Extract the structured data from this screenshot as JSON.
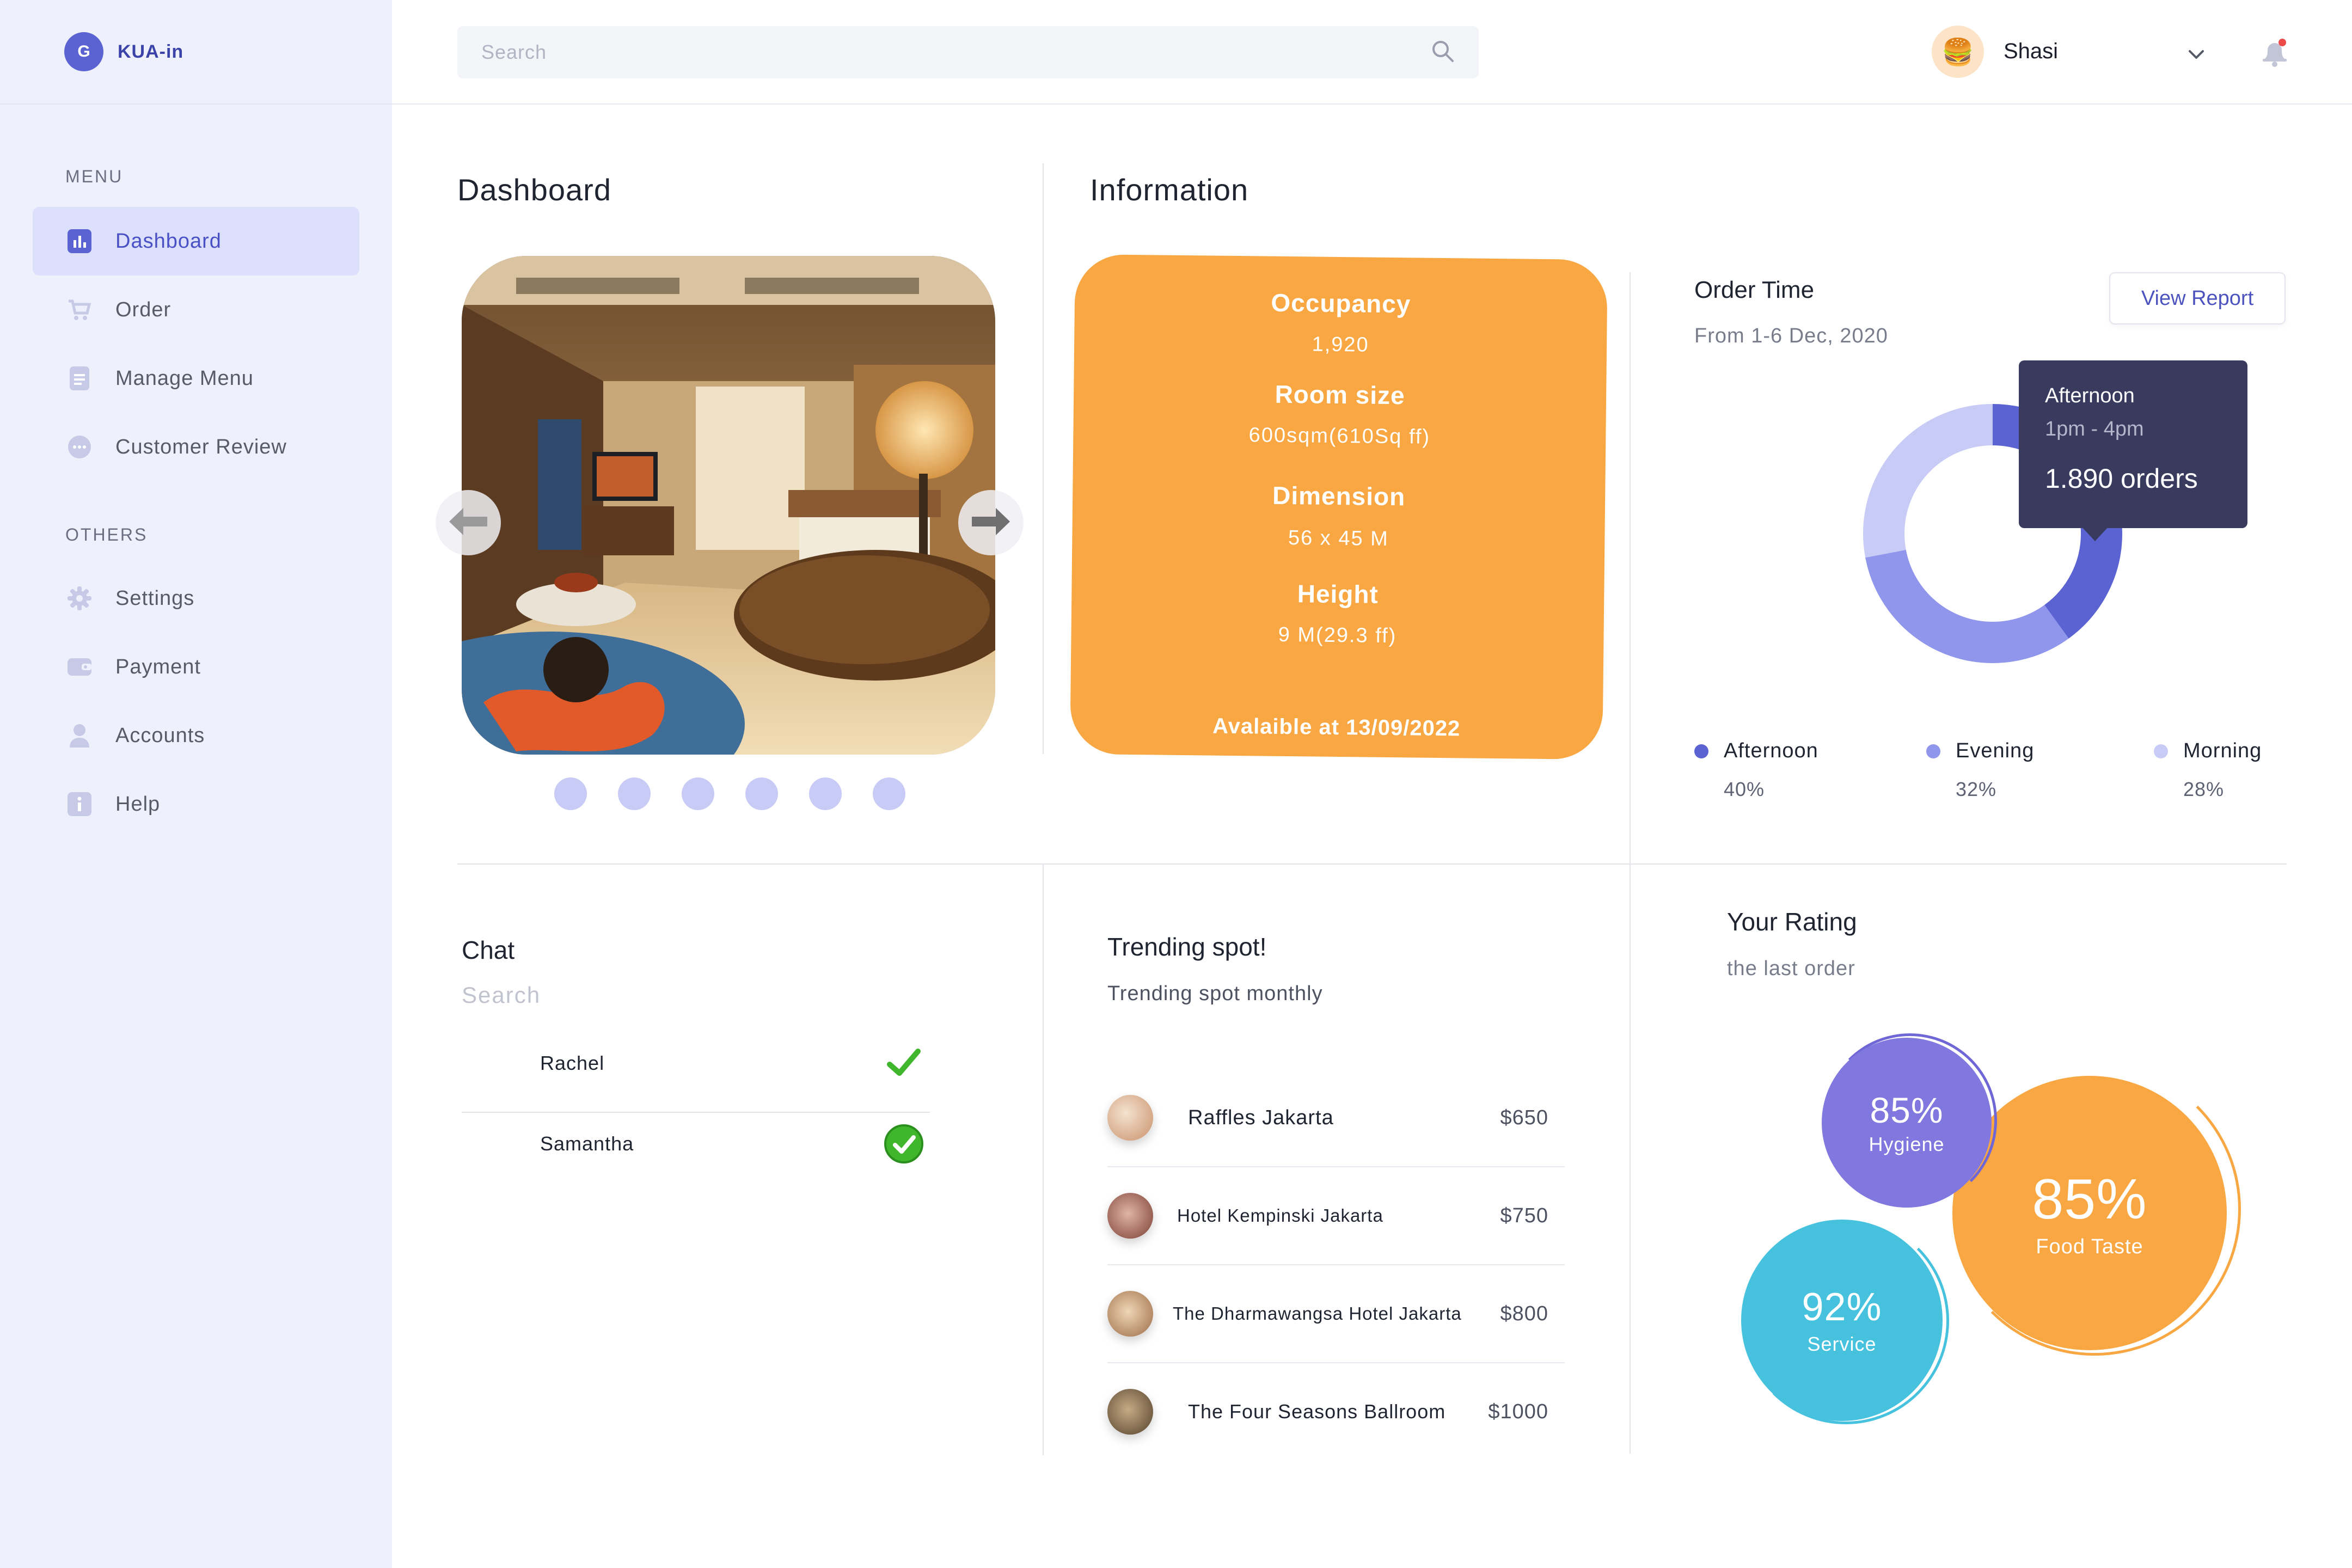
{
  "brand": {
    "initial": "G",
    "name": "KUA-in"
  },
  "sidebar": {
    "menu_label": "MENU",
    "menu_items": [
      {
        "label": "Dashboard",
        "icon": "chart-bar-icon",
        "active": true
      },
      {
        "label": "Order",
        "icon": "cart-icon",
        "active": false
      },
      {
        "label": "Manage Menu",
        "icon": "document-icon",
        "active": false
      },
      {
        "label": "Customer Review",
        "icon": "chat-bubble-icon",
        "active": false
      }
    ],
    "others_label": "OTHERS",
    "other_items": [
      {
        "label": "Settings",
        "icon": "gear-icon"
      },
      {
        "label": "Payment",
        "icon": "wallet-icon"
      },
      {
        "label": "Accounts",
        "icon": "user-icon"
      },
      {
        "label": "Help",
        "icon": "info-icon"
      }
    ]
  },
  "header": {
    "search_placeholder": "Search",
    "user_name": "Shasi",
    "avatar_emoji": "🍔"
  },
  "dashboard": {
    "title": "Dashboard",
    "carousel_dots": 6
  },
  "information": {
    "title": "Information",
    "occupancy_label": "Occupancy",
    "occupancy_value": "1,920",
    "room_size_label": "Room size",
    "room_size_value": "600sqm(610Sq ff)",
    "dimension_label": "Dimension",
    "dimension_value": "56 x 45 M",
    "height_label": "Height",
    "height_value": "9 M(29.3 ff)",
    "available": "Avalaible at 13/09/2022"
  },
  "order_time": {
    "title": "Order Time",
    "subtitle": "From 1-6 Dec, 2020",
    "view_report": "View Report",
    "tooltip": {
      "title": "Afternoon",
      "time": "1pm - 4pm",
      "orders": "1.890 orders"
    },
    "legend": [
      {
        "name": "Afternoon",
        "pct": "40%",
        "color": "#5b63d3"
      },
      {
        "name": "Evening",
        "pct": "32%",
        "color": "#8f96ec"
      },
      {
        "name": "Morning",
        "pct": "28%",
        "color": "#c8cbf6"
      }
    ]
  },
  "chat": {
    "title": "Chat",
    "search_placeholder": "Search",
    "contacts": [
      {
        "name": "Rachel"
      },
      {
        "name": "Samantha"
      }
    ]
  },
  "trending": {
    "title": "Trending spot!",
    "subtitle": "Trending spot monthly",
    "spots": [
      {
        "name": "Raffles Jakarta",
        "price": "$650"
      },
      {
        "name": "Hotel Kempinski Jakarta",
        "price": "$750"
      },
      {
        "name": "The Dharmawangsa Hotel Jakarta",
        "price": "$800"
      },
      {
        "name": "The Four Seasons Ballroom",
        "price": "$1000"
      }
    ]
  },
  "rating": {
    "title": "Your Rating",
    "subtitle": "the last order",
    "items": [
      {
        "pct": "85%",
        "label": "Hygiene",
        "color": "#8077df"
      },
      {
        "pct": "85%",
        "label": "Food Taste",
        "color": "#f8a743"
      },
      {
        "pct": "92%",
        "label": "Service",
        "color": "#46c2de"
      }
    ]
  }
}
